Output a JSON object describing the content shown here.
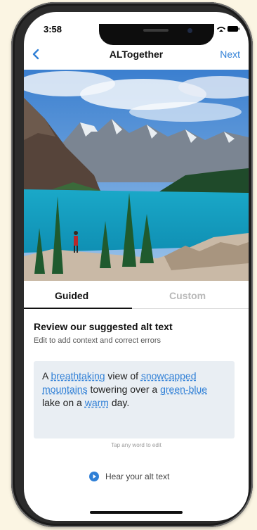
{
  "status_bar": {
    "time": "3:58"
  },
  "nav": {
    "back_icon": "chevron-left-icon",
    "title": "ALTogether",
    "next_label": "Next"
  },
  "photo": {
    "subject": "mountain-lake-photo"
  },
  "tabs": [
    {
      "label": "Guided",
      "selected": true
    },
    {
      "label": "Custom",
      "selected": false
    }
  ],
  "review": {
    "heading": "Review our suggested alt text",
    "subheading": "Edit to add context and correct errors",
    "alt_text": {
      "w1": "A",
      "w2": "breathtaking",
      "w3": "view of",
      "w4": "snowcapped",
      "w5": "mountains",
      "w6": "towering over a",
      "w7": "green-blue",
      "w8": "lake on a",
      "w9": "warm",
      "w10": "day."
    },
    "tap_hint": "Tap any word to edit"
  },
  "hear": {
    "icon": "play-circle-icon",
    "label": "Hear your alt text"
  },
  "colors": {
    "accent": "#2f7fd6",
    "box_background": "#e9eef3",
    "page_background": "#fbf5e3"
  }
}
